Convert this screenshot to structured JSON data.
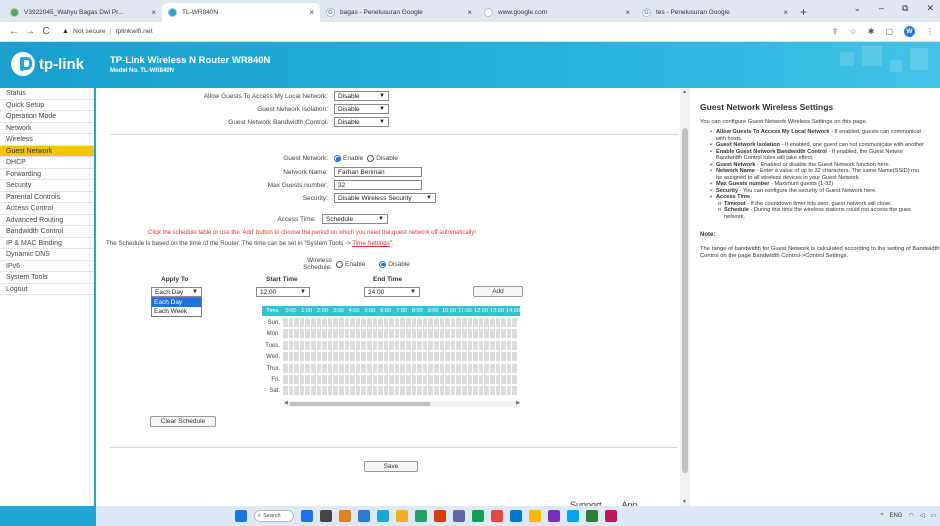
{
  "browser": {
    "tabs": [
      {
        "title": "V3922045_Wahyu Bagas Dwi Pr...",
        "fav_color": "#4caf50",
        "fav_glyph": "",
        "active": false
      },
      {
        "title": "TL-WR840N",
        "fav_color": "#1ea6d4",
        "fav_glyph": "",
        "active": true
      },
      {
        "title": "bagas - Penelusuran Google",
        "fav_color": "#ffffff",
        "fav_glyph": "G",
        "active": false
      },
      {
        "title": "www.google.com",
        "fav_color": "#ffffff",
        "fav_glyph": "",
        "active": false
      },
      {
        "title": "tes - Penelusuran Google",
        "fav_color": "#ffffff",
        "fav_glyph": "G",
        "active": false
      }
    ],
    "address_warning": "Not secure",
    "address_url": "tplinkwifi.net",
    "profile_initial": "W"
  },
  "router": {
    "logo_text": "tp-link",
    "title": "TP-Link Wireless N Router WR840N",
    "model": "Model No. TL-WR840N"
  },
  "menu": [
    {
      "label": "Status",
      "active": false
    },
    {
      "label": "Quick Setup",
      "active": false
    },
    {
      "label": "Operation Mode",
      "active": false
    },
    {
      "label": "Network",
      "active": false
    },
    {
      "label": "Wireless",
      "active": false
    },
    {
      "label": "Guest Network",
      "active": true
    },
    {
      "label": "DHCP",
      "active": false
    },
    {
      "label": "Forwarding",
      "active": false
    },
    {
      "label": "Security",
      "active": false
    },
    {
      "label": "Parental Controls",
      "active": false
    },
    {
      "label": "Access Control",
      "active": false
    },
    {
      "label": "Advanced Routing",
      "active": false
    },
    {
      "label": "Bandwidth Control",
      "active": false
    },
    {
      "label": "IP & MAC Binding",
      "active": false
    },
    {
      "label": "Dynamic DNS",
      "active": false
    },
    {
      "label": "IPv6",
      "active": false
    },
    {
      "label": "System Tools",
      "active": false
    },
    {
      "label": "Logout",
      "active": false
    }
  ],
  "form": {
    "allow_guests_label": "Allow Guests To Access My Local Network:",
    "allow_guests_value": "Disable",
    "isolation_label": "Guest Network Isolation:",
    "isolation_value": "Disable",
    "bw_control_label": "Guest Network Bandwidth Control:",
    "bw_control_value": "Disable",
    "guest_network_label": "Guest Network:",
    "guest_network_enable": "Enable",
    "guest_network_disable": "Disable",
    "network_name_label": "Network Name:",
    "network_name_value": "Farhan Beriman",
    "max_guests_label": "Max Guests number:",
    "max_guests_value": "32",
    "security_label": "Security:",
    "security_value": "Disable Wireless Security",
    "access_time_label": "Access Time:",
    "access_time_value": "Schedule",
    "red_note": "Click the schedule table or use the 'Add' button to choose the period on which you need the guest network off automatically!",
    "schedule_note": "The Schedule is based on the time of the Router. The time can be set in \"System Tools -> ",
    "schedule_link": "Time Settings",
    "schedule_note_end": "\".",
    "wireless_schedule_label": "Wireless Schedule:",
    "ws_enable": "Enable",
    "ws_disable": "Disable",
    "apply_to_label": "Apply To",
    "start_time_label": "Start Time",
    "end_time_label": "End Time",
    "apply_to_value": "Each Day",
    "apply_to_options": [
      "Each Day",
      "Each Week"
    ],
    "start_time_value": "12:00",
    "end_time_value": "24:00",
    "add_button": "Add",
    "clear_button": "Clear Schedule",
    "save_button": "Save"
  },
  "schedule": {
    "time_header": "Time",
    "hours": [
      "0:00",
      "1:00",
      "2:00",
      "3:00",
      "4:00",
      "5:00",
      "6:00",
      "7:00",
      "8:00",
      "9:00",
      "10:00",
      "11:00",
      "12:00",
      "13:00",
      "14:00"
    ],
    "days": [
      "Sun.",
      "Mon.",
      "Tues.",
      "Wed.",
      "Thur.",
      "Fri.",
      "Sat."
    ],
    "header_color": "#35c2d2"
  },
  "help": {
    "title": "Guest Network Wireless Settings",
    "intro": "You can configure Guest Network Wireless Settings on this page.",
    "items": [
      {
        "term": "Allow Guests To Access My Local Network",
        "desc": " - If enabled, guests can communicat",
        "cont": "with hosts."
      },
      {
        "term": "Guest Network Isolation",
        "desc": " - If enabled, one guest can not communicate with another",
        "cont": ""
      },
      {
        "term": "Enable Guest Network Bandwidth Control",
        "desc": " - If enabled, the Guest Networ",
        "cont": "Bandwidth Control rules will take effect."
      },
      {
        "term": "Guest Network",
        "desc": " - Enabled or disable the Guest Network function here.",
        "cont": ""
      },
      {
        "term": "Network Name",
        "desc": " - Enter a value of up to 32 characters. The same Name(SSID) mu",
        "cont": "be assigned to all wireless devices in your Guest Network."
      },
      {
        "term": "Max Guests number",
        "desc": " - Maximum guests (1-32)",
        "cont": ""
      },
      {
        "term": "Security",
        "desc": " - You can configure the security of Guest Network here.",
        "cont": ""
      },
      {
        "term": "Access Time",
        "desc": "",
        "cont": ""
      }
    ],
    "sub_items": [
      {
        "term": "Timeout",
        "desc": " - If the countdown timer hits zero, guest network will close.",
        "cont": ""
      },
      {
        "term": "Schedule",
        "desc": " - During this time the wireless stations could not access the gues",
        "cont": "network."
      }
    ],
    "note_title": "Note:",
    "note_text": "The range of bandwidth for Guest Network is calculated according to the setting of Bandwidth Control on the page Bandwidth Control->Control Settings."
  },
  "footer": {
    "support": "Support",
    "app": "App"
  },
  "taskbar": {
    "search_label": "Search",
    "tray_lang": "ENG",
    "icon_colors": [
      "#1a73e8",
      "#444444",
      "#e67e22",
      "#2b7bd6",
      "#1ea6d4",
      "#f2b01e",
      "#21a366",
      "#d83b01",
      "#6264a7",
      "#0f9d58",
      "#e8453c",
      "#0078d4",
      "#ffb900",
      "#7b2fbe",
      "#00a4ef",
      "#2e7d32",
      "#c2185b"
    ]
  }
}
